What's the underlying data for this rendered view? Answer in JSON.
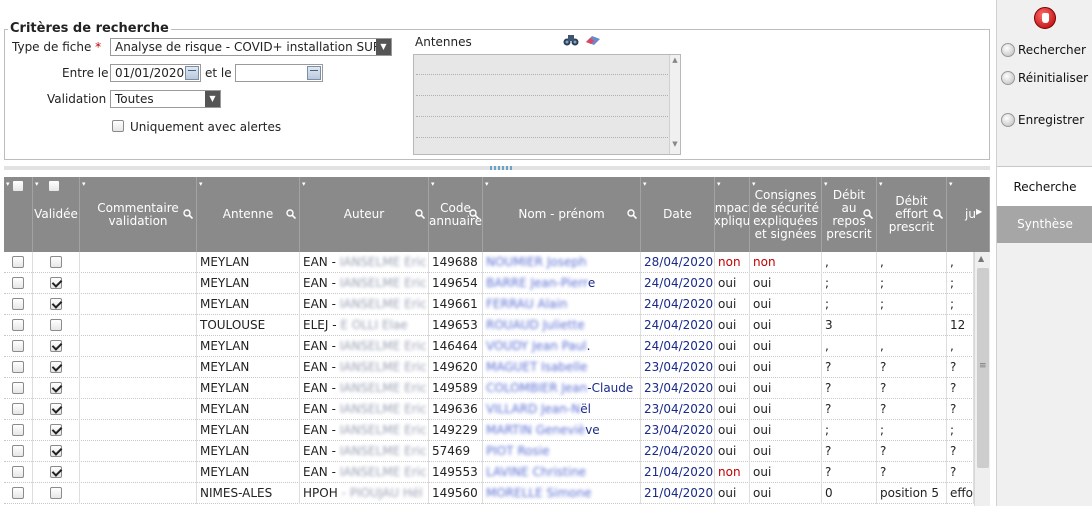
{
  "criteria": {
    "title": "Critères de recherche",
    "type_label": "Type de fiche",
    "required_mark": "*",
    "type_value": "Analyse de risque - COVID+ installation SUR",
    "between_label": "Entre le",
    "date_from": "01/01/2020",
    "and_label": "et le",
    "date_to": "",
    "validation_label": "Validation",
    "validation_value": "Toutes",
    "alerts_label": "Uniquement avec alertes",
    "antennes_label": "Antennes"
  },
  "panel": {
    "search": "Rechercher",
    "reset": "Réinitialiser",
    "save": "Enregistrer",
    "tab_search": "Recherche",
    "tab_synthesis": "Synthèse"
  },
  "grid": {
    "headers": {
      "validee": "Validée",
      "commentaire": "Commentaire validation",
      "antenne": "Antenne",
      "auteur": "Auteur",
      "code": "Code annuaire",
      "nom": "Nom - prénom",
      "date": "Date",
      "impact": "Impact expliqué",
      "consignes": "Consignes de sécurité expliquées et signées",
      "debit_repos": "Débit au repos prescrit",
      "debit_effort": "Débit effort prescrit",
      "last": "ju"
    },
    "rows": [
      {
        "validated": false,
        "antenne": "MEYLAN",
        "auteur": "EAN -",
        "auteur_hidden": "IANSELME Eric",
        "code": "149688",
        "nom_hidden": "NOUMIER Joseph",
        "nom_visible": "",
        "date": "28/04/2020",
        "impact": "non",
        "consignes": "non",
        "repos": ",",
        "effort": ",",
        "last": ","
      },
      {
        "validated": true,
        "antenne": "MEYLAN",
        "auteur": "EAN -",
        "auteur_hidden": "IANSELME Eric",
        "code": "149654",
        "nom_hidden": "BARRE Jean-Pierr",
        "nom_visible": "e",
        "date": "24/04/2020",
        "impact": "oui",
        "consignes": "oui",
        "repos": ";",
        "effort": ";",
        "last": ";"
      },
      {
        "validated": true,
        "antenne": "MEYLAN",
        "auteur": "EAN -",
        "auteur_hidden": "IANSELME Eric",
        "code": "149661",
        "nom_hidden": "FERRAU Alain",
        "nom_visible": "",
        "date": "24/04/2020",
        "impact": "oui",
        "consignes": "oui",
        "repos": ";",
        "effort": ";",
        "last": ";"
      },
      {
        "validated": false,
        "antenne": "TOULOUSE",
        "auteur": "ELEJ -",
        "auteur_hidden": "E OLLI Elae",
        "code": "149653",
        "nom_hidden": "ROUAUD Juliette",
        "nom_visible": "",
        "date": "24/04/2020",
        "impact": "oui",
        "consignes": "oui",
        "repos": "3",
        "effort": "",
        "last": "12"
      },
      {
        "validated": true,
        "antenne": "MEYLAN",
        "auteur": "EAN -",
        "auteur_hidden": "IANSELME Eric",
        "code": "146464",
        "nom_hidden": "VOUDY Jean Paul",
        "nom_visible": ".",
        "date": "24/04/2020",
        "impact": "oui",
        "consignes": "oui",
        "repos": ",",
        "effort": ",",
        "last": ","
      },
      {
        "validated": true,
        "antenne": "MEYLAN",
        "auteur": "EAN -",
        "auteur_hidden": "IANSELME Eric",
        "code": "149620",
        "nom_hidden": "MAGUET Isabelle",
        "nom_visible": "",
        "date": "23/04/2020",
        "impact": "oui",
        "consignes": "oui",
        "repos": "?",
        "effort": "?",
        "last": "?"
      },
      {
        "validated": true,
        "antenne": "MEYLAN",
        "auteur": "EAN -",
        "auteur_hidden": "IANSELME Eric",
        "code": "149589",
        "nom_hidden": "COLOMBIER Jean",
        "nom_visible": "-Claude",
        "date": "23/04/2020",
        "impact": "oui",
        "consignes": "oui",
        "repos": "?",
        "effort": "?",
        "last": "?"
      },
      {
        "validated": true,
        "antenne": "MEYLAN",
        "auteur": "EAN -",
        "auteur_hidden": "IANSELME Eric",
        "code": "149636",
        "nom_hidden": "VILLARD Jean-N",
        "nom_visible": "ël",
        "date": "23/04/2020",
        "impact": "oui",
        "consignes": "oui",
        "repos": "?",
        "effort": "?",
        "last": "?"
      },
      {
        "validated": true,
        "antenne": "MEYLAN",
        "auteur": "EAN -",
        "auteur_hidden": "IANSELME Eric",
        "code": "149229",
        "nom_hidden": "MARTIN Geneviè",
        "nom_visible": "ve",
        "date": "23/04/2020",
        "impact": "oui",
        "consignes": "oui",
        "repos": ";",
        "effort": ";",
        "last": ";"
      },
      {
        "validated": true,
        "antenne": "MEYLAN",
        "auteur": "EAN -",
        "auteur_hidden": "IANSELME Eric",
        "code": "57469",
        "nom_hidden": "PIOT Rosie",
        "nom_visible": "",
        "date": "22/04/2020",
        "impact": "oui",
        "consignes": "oui",
        "repos": "?",
        "effort": "?",
        "last": "?"
      },
      {
        "validated": true,
        "antenne": "MEYLAN",
        "auteur": "EAN -",
        "auteur_hidden": "IANSELME Eric",
        "code": "149553",
        "nom_hidden": "LAVINE Christine",
        "nom_visible": "",
        "date": "21/04/2020",
        "impact": "non",
        "consignes": "oui",
        "repos": "?",
        "effort": "?",
        "last": "?"
      },
      {
        "validated": false,
        "antenne": "NIMES-ALES",
        "auteur": "HPOH",
        "auteur_hidden": "- PIOUJAU Hél",
        "code": "149560",
        "nom_hidden": "MORELLE Simone",
        "nom_visible": "",
        "date": "21/04/2020",
        "impact": "oui",
        "consignes": "oui",
        "repos": "0",
        "effort": "position 5",
        "last": "effo"
      }
    ]
  }
}
